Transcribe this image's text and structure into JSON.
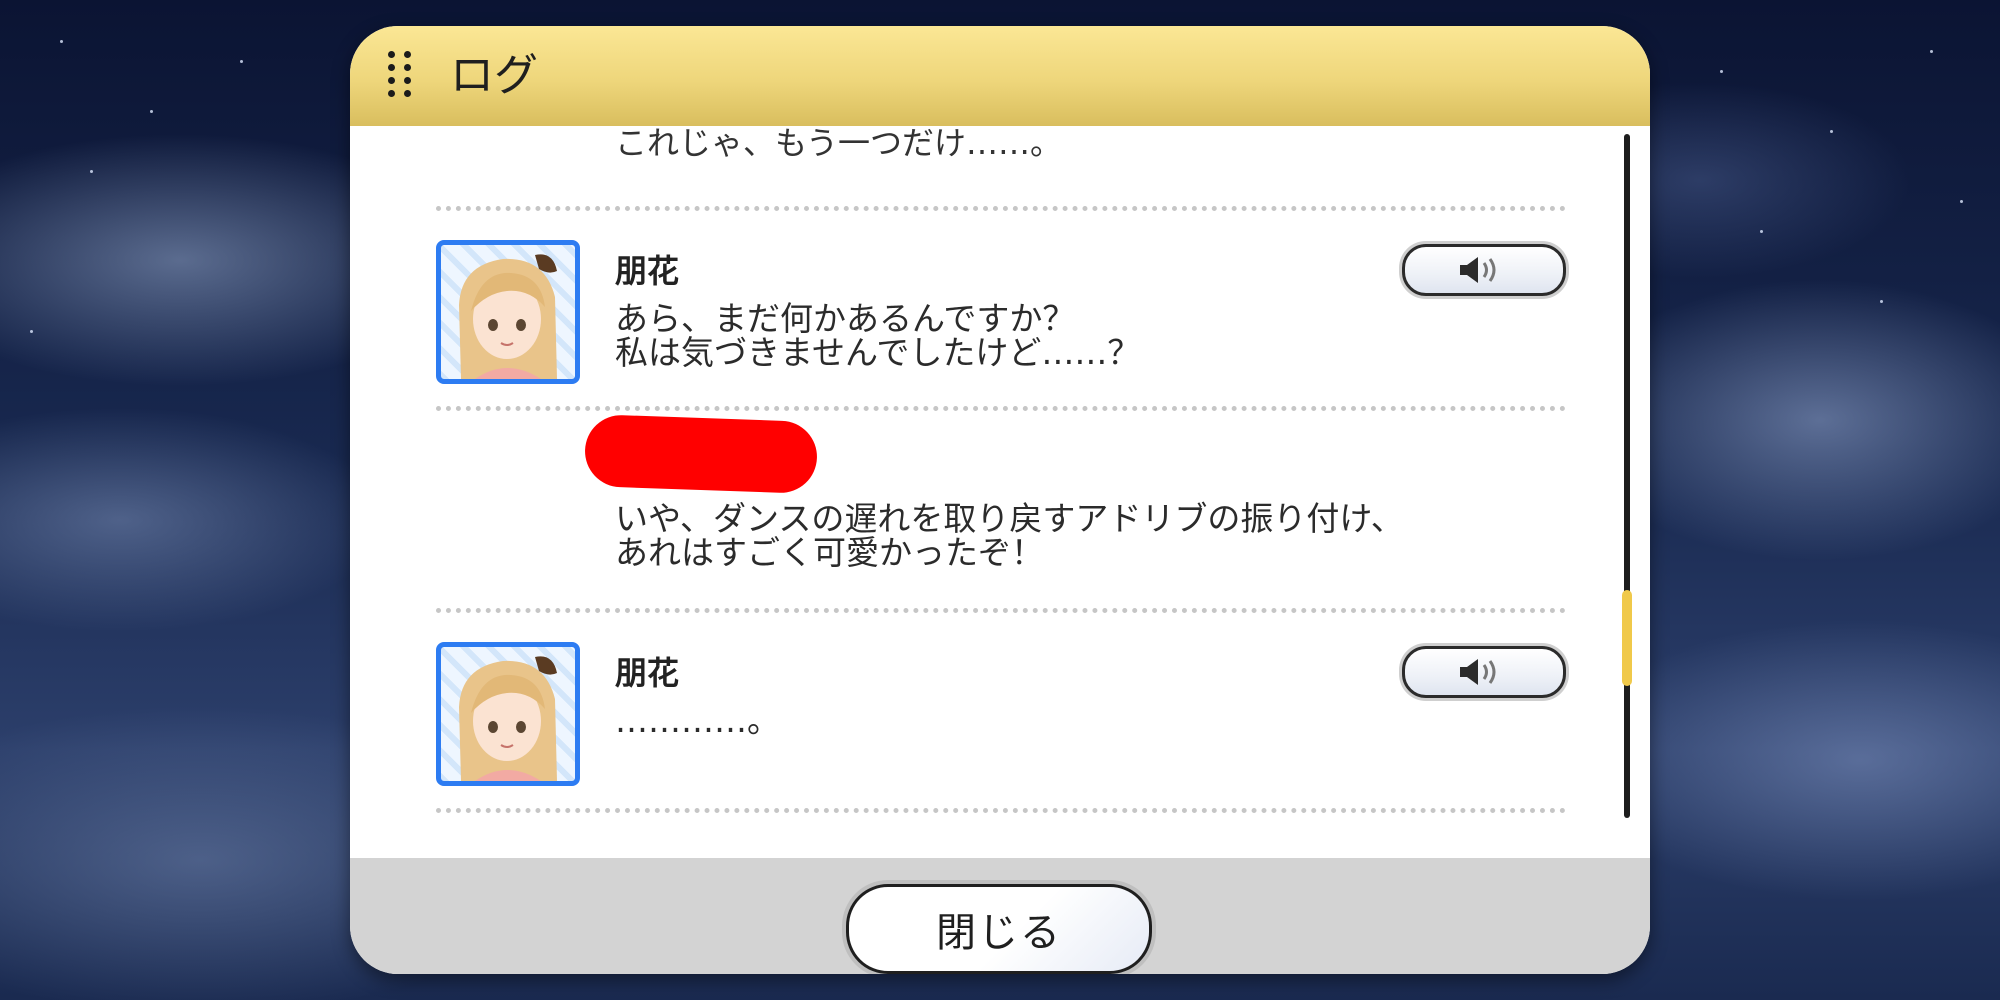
{
  "window": {
    "title": "ログ"
  },
  "log": {
    "cutoff_text": "これじゃ、もう一つだけ……。",
    "entries": [
      {
        "speaker": "朋花",
        "lines": [
          "あら、まだ何かあるんですか？",
          "私は気づきませんでしたけど……？"
        ],
        "has_voice": true
      },
      {
        "speaker": "",
        "speaker_redacted": true,
        "lines": [
          "いや、ダンスの遅れを取り戻すアドリブの振り付け、",
          "あれはすごく可愛かったぞ！"
        ],
        "has_voice": false
      },
      {
        "speaker": "朋花",
        "lines": [
          "…………。"
        ],
        "has_voice": true
      }
    ]
  },
  "footer": {
    "close_label": "閉じる"
  },
  "colors": {
    "header_gold": "#eed67b",
    "avatar_border": "#2d7cf2",
    "scroll_thumb": "#f0c94a",
    "footer_gray": "#d3d3d3",
    "redaction": "#ff0000"
  },
  "icons": {
    "voice": "speaker-icon",
    "grip": "drag-handle-icon"
  }
}
